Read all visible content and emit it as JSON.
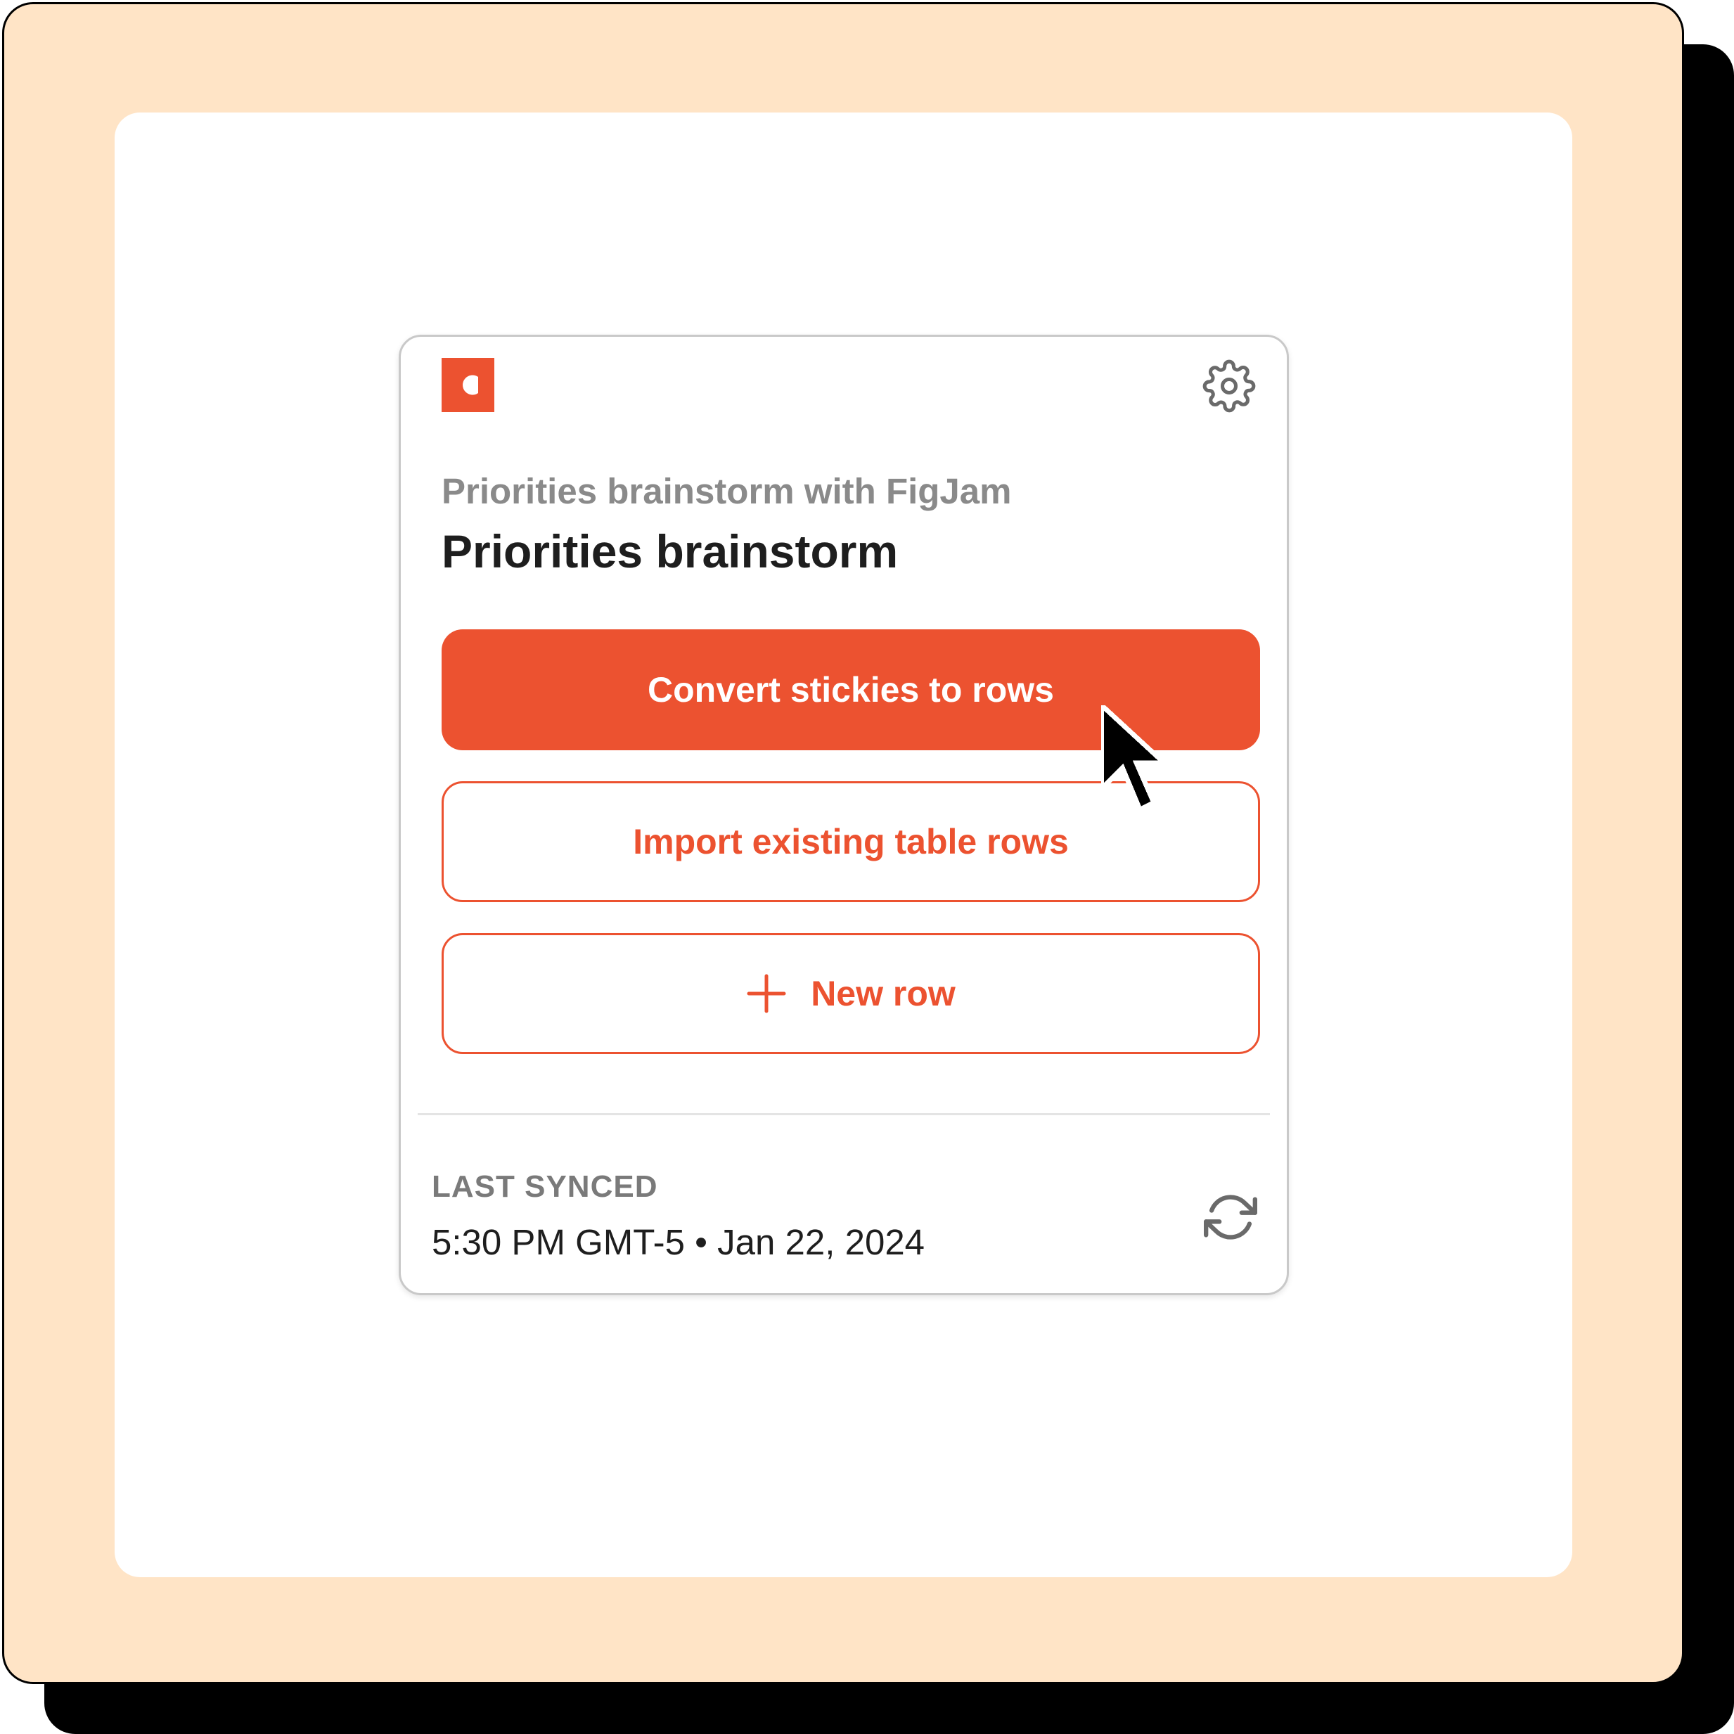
{
  "colors": {
    "accent": "#ec5230",
    "frame_background": "#ffe4c6",
    "title": "#1e1e1e",
    "subtitle": "#8a8a8a"
  },
  "header": {
    "logo_icon": "coda-logo-icon",
    "settings_icon": "gear-icon"
  },
  "doc": {
    "subtitle": "Priorities brainstorm with FigJam",
    "title": "Priorities brainstorm"
  },
  "actions": {
    "convert_label": "Convert stickies to rows",
    "import_label": "Import existing table rows",
    "new_row_label": "New row",
    "new_row_icon": "plus-icon"
  },
  "sync": {
    "label": "LAST SYNCED",
    "timestamp": "5:30 PM GMT-5 • Jan 22, 2024",
    "refresh_icon": "refresh-icon"
  },
  "pointer": {
    "icon": "mouse-pointer-icon"
  }
}
